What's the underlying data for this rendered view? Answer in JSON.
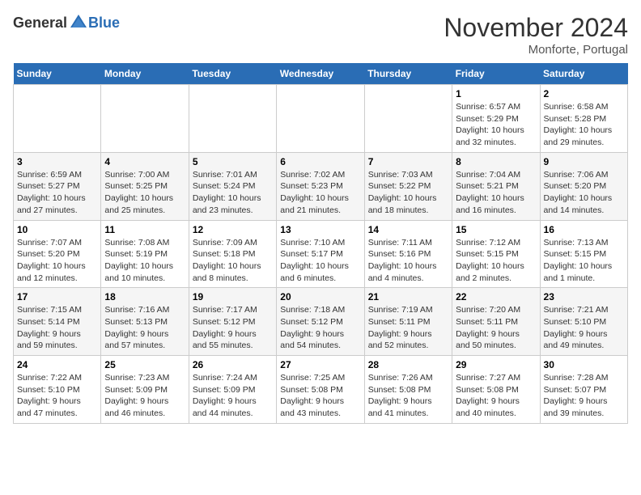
{
  "header": {
    "logo_general": "General",
    "logo_blue": "Blue",
    "month": "November 2024",
    "location": "Monforte, Portugal"
  },
  "weekdays": [
    "Sunday",
    "Monday",
    "Tuesday",
    "Wednesday",
    "Thursday",
    "Friday",
    "Saturday"
  ],
  "weeks": [
    [
      {
        "day": "",
        "info": ""
      },
      {
        "day": "",
        "info": ""
      },
      {
        "day": "",
        "info": ""
      },
      {
        "day": "",
        "info": ""
      },
      {
        "day": "",
        "info": ""
      },
      {
        "day": "1",
        "info": "Sunrise: 6:57 AM\nSunset: 5:29 PM\nDaylight: 10 hours\nand 32 minutes."
      },
      {
        "day": "2",
        "info": "Sunrise: 6:58 AM\nSunset: 5:28 PM\nDaylight: 10 hours\nand 29 minutes."
      }
    ],
    [
      {
        "day": "3",
        "info": "Sunrise: 6:59 AM\nSunset: 5:27 PM\nDaylight: 10 hours\nand 27 minutes."
      },
      {
        "day": "4",
        "info": "Sunrise: 7:00 AM\nSunset: 5:25 PM\nDaylight: 10 hours\nand 25 minutes."
      },
      {
        "day": "5",
        "info": "Sunrise: 7:01 AM\nSunset: 5:24 PM\nDaylight: 10 hours\nand 23 minutes."
      },
      {
        "day": "6",
        "info": "Sunrise: 7:02 AM\nSunset: 5:23 PM\nDaylight: 10 hours\nand 21 minutes."
      },
      {
        "day": "7",
        "info": "Sunrise: 7:03 AM\nSunset: 5:22 PM\nDaylight: 10 hours\nand 18 minutes."
      },
      {
        "day": "8",
        "info": "Sunrise: 7:04 AM\nSunset: 5:21 PM\nDaylight: 10 hours\nand 16 minutes."
      },
      {
        "day": "9",
        "info": "Sunrise: 7:06 AM\nSunset: 5:20 PM\nDaylight: 10 hours\nand 14 minutes."
      }
    ],
    [
      {
        "day": "10",
        "info": "Sunrise: 7:07 AM\nSunset: 5:20 PM\nDaylight: 10 hours\nand 12 minutes."
      },
      {
        "day": "11",
        "info": "Sunrise: 7:08 AM\nSunset: 5:19 PM\nDaylight: 10 hours\nand 10 minutes."
      },
      {
        "day": "12",
        "info": "Sunrise: 7:09 AM\nSunset: 5:18 PM\nDaylight: 10 hours\nand 8 minutes."
      },
      {
        "day": "13",
        "info": "Sunrise: 7:10 AM\nSunset: 5:17 PM\nDaylight: 10 hours\nand 6 minutes."
      },
      {
        "day": "14",
        "info": "Sunrise: 7:11 AM\nSunset: 5:16 PM\nDaylight: 10 hours\nand 4 minutes."
      },
      {
        "day": "15",
        "info": "Sunrise: 7:12 AM\nSunset: 5:15 PM\nDaylight: 10 hours\nand 2 minutes."
      },
      {
        "day": "16",
        "info": "Sunrise: 7:13 AM\nSunset: 5:15 PM\nDaylight: 10 hours\nand 1 minute."
      }
    ],
    [
      {
        "day": "17",
        "info": "Sunrise: 7:15 AM\nSunset: 5:14 PM\nDaylight: 9 hours\nand 59 minutes."
      },
      {
        "day": "18",
        "info": "Sunrise: 7:16 AM\nSunset: 5:13 PM\nDaylight: 9 hours\nand 57 minutes."
      },
      {
        "day": "19",
        "info": "Sunrise: 7:17 AM\nSunset: 5:12 PM\nDaylight: 9 hours\nand 55 minutes."
      },
      {
        "day": "20",
        "info": "Sunrise: 7:18 AM\nSunset: 5:12 PM\nDaylight: 9 hours\nand 54 minutes."
      },
      {
        "day": "21",
        "info": "Sunrise: 7:19 AM\nSunset: 5:11 PM\nDaylight: 9 hours\nand 52 minutes."
      },
      {
        "day": "22",
        "info": "Sunrise: 7:20 AM\nSunset: 5:11 PM\nDaylight: 9 hours\nand 50 minutes."
      },
      {
        "day": "23",
        "info": "Sunrise: 7:21 AM\nSunset: 5:10 PM\nDaylight: 9 hours\nand 49 minutes."
      }
    ],
    [
      {
        "day": "24",
        "info": "Sunrise: 7:22 AM\nSunset: 5:10 PM\nDaylight: 9 hours\nand 47 minutes."
      },
      {
        "day": "25",
        "info": "Sunrise: 7:23 AM\nSunset: 5:09 PM\nDaylight: 9 hours\nand 46 minutes."
      },
      {
        "day": "26",
        "info": "Sunrise: 7:24 AM\nSunset: 5:09 PM\nDaylight: 9 hours\nand 44 minutes."
      },
      {
        "day": "27",
        "info": "Sunrise: 7:25 AM\nSunset: 5:08 PM\nDaylight: 9 hours\nand 43 minutes."
      },
      {
        "day": "28",
        "info": "Sunrise: 7:26 AM\nSunset: 5:08 PM\nDaylight: 9 hours\nand 41 minutes."
      },
      {
        "day": "29",
        "info": "Sunrise: 7:27 AM\nSunset: 5:08 PM\nDaylight: 9 hours\nand 40 minutes."
      },
      {
        "day": "30",
        "info": "Sunrise: 7:28 AM\nSunset: 5:07 PM\nDaylight: 9 hours\nand 39 minutes."
      }
    ]
  ]
}
